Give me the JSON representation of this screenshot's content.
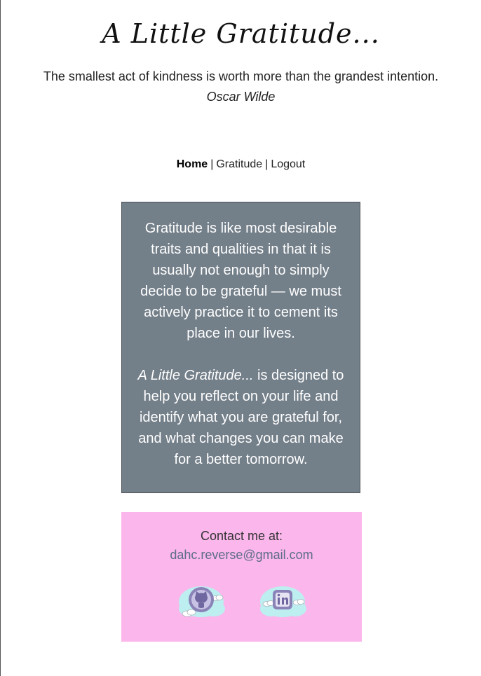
{
  "header": {
    "title": "A Little Gratitude...",
    "quote": "The smallest act of kindness is worth more than the grandest intention.",
    "quote_author": "Oscar Wilde"
  },
  "nav": {
    "items": [
      {
        "label": "Home",
        "active": true
      },
      {
        "label": "Gratitude",
        "active": false
      },
      {
        "label": "Logout",
        "active": false
      }
    ],
    "separator": "|"
  },
  "about": {
    "paragraph1": "Gratitude is like most desirable traits and qualities in that it is usually not enough to simply decide to be grateful — we must actively practice it to cement its place in our lives.",
    "app_name": "A Little Gratitude...",
    "paragraph2_rest": " is designed to help you reflect on your life and identify what you are grateful for, and what changes you can make for a better tomorrow."
  },
  "contact": {
    "heading": "Contact me at:",
    "email": "dahc.reverse@gmail.com",
    "social": [
      {
        "icon": "github-icon"
      },
      {
        "icon": "linkedin-icon"
      }
    ]
  },
  "colors": {
    "about_bg": "#737f89",
    "contact_bg": "#fbb6ec",
    "email_link": "#5d6d88",
    "cloud": "#bdeef0",
    "icon_purple": "#8a83b8"
  }
}
